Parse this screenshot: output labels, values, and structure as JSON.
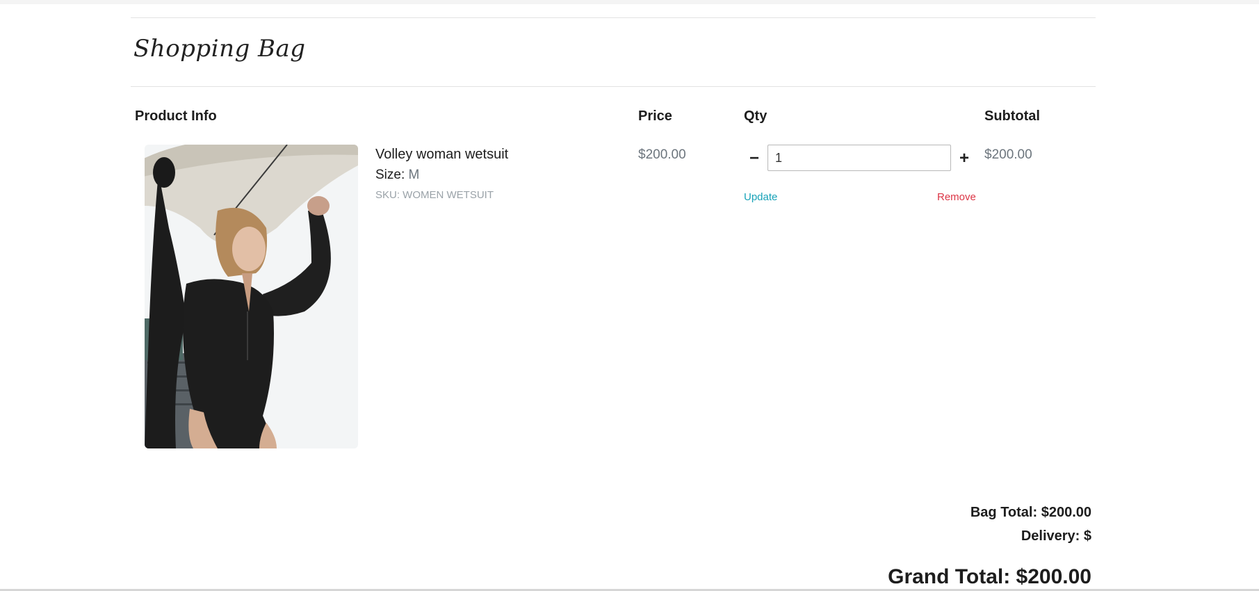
{
  "page": {
    "title": "Shopping Bag"
  },
  "table": {
    "headers": {
      "product_info": "Product Info",
      "price": "Price",
      "qty": "Qty",
      "subtotal": "Subtotal"
    }
  },
  "item": {
    "name": "Volley woman wetsuit",
    "size_label": "Size:",
    "size_value": "M",
    "sku": "SKU: WOMEN WETSUIT",
    "price": "$200.00",
    "quantity": "1",
    "decrement_label": "−",
    "increment_label": "+",
    "update_label": "Update",
    "remove_label": "Remove",
    "subtotal": "$200.00",
    "image_alt": "Woman in black wetsuit carrying a surfboard overhead"
  },
  "totals": {
    "bag_total": "Bag Total: $200.00",
    "delivery": "Delivery: $",
    "grand_total": "Grand Total: $200.00"
  },
  "colors": {
    "update_link": "#17a2b8",
    "remove_link": "#dc3545",
    "muted_text": "#6c757d"
  }
}
